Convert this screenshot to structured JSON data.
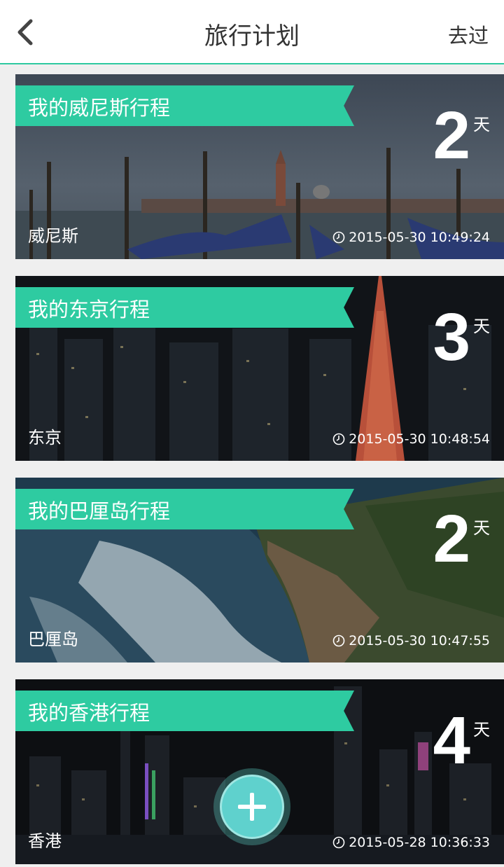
{
  "header": {
    "title": "旅行计划",
    "right_action": "去过"
  },
  "colors": {
    "accent": "#2ecba1",
    "header_border": "#2ec9a0",
    "fab": "#5fd1cd"
  },
  "icons": {
    "back": "chevron-left-icon",
    "clock": "clock-icon",
    "add": "plus-icon"
  },
  "trips": [
    {
      "title": "我的威尼斯行程",
      "days": "2",
      "unit": "天",
      "place": "威尼斯",
      "time": "2015-05-30 10:49:24"
    },
    {
      "title": "我的东京行程",
      "days": "3",
      "unit": "天",
      "place": "东京",
      "time": "2015-05-30 10:48:54"
    },
    {
      "title": "我的巴厘岛行程",
      "days": "2",
      "unit": "天",
      "place": "巴厘岛",
      "time": "2015-05-30 10:47:55"
    },
    {
      "title": "我的香港行程",
      "days": "4",
      "unit": "天",
      "place": "香港",
      "time": "2015-05-28 10:36:33"
    }
  ]
}
